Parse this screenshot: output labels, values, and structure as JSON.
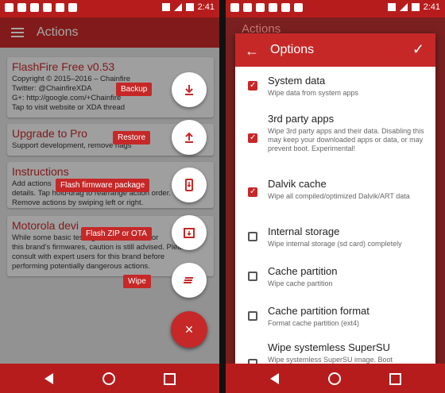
{
  "status": {
    "time": "2:41"
  },
  "left": {
    "appbar_title": "Actions",
    "cards": [
      {
        "title": "FlashFire Free v0.53",
        "lines": [
          "Copyright © 2015–2016 – Chainfire",
          "Twitter: @ChainfireXDA",
          "G+: http://google.com/+Chainfire",
          "Tap to visit website or XDA thread"
        ]
      },
      {
        "title": "Upgrade to Pro",
        "lines": [
          "Support development, remove nags"
        ]
      },
      {
        "title": "Instructions",
        "lines": [
          "Add actions",
          "details. Tap hold-drag to rearrange action order.",
          "Remove actions by swiping left or right."
        ]
      },
      {
        "title": "Motorola devi",
        "lines": [
          "While some basic testing has been done for",
          "this brand's firmwares, caution is still advised. Please",
          "consult with expert users for this brand before",
          "performing potentially dangerous actions."
        ]
      }
    ],
    "fab_labels": {
      "backup": "Backup",
      "restore": "Restore",
      "flash_firmware": "Flash firmware package",
      "flash_zip": "Flash ZIP or OTA",
      "wipe": "Wipe"
    },
    "fab_main": "×"
  },
  "right": {
    "bg_title": "Actions",
    "dialog_title": "Options",
    "back_glyph": "←",
    "confirm_glyph": "✓",
    "options": [
      {
        "title": "System data",
        "desc": "Wipe data from system apps",
        "checked": true
      },
      {
        "title": "3rd party apps",
        "desc": "Wipe 3rd party apps and their data. Disabling this may keep your downloaded apps or data, or may prevent boot. Experimental!",
        "checked": true
      },
      {
        "title": "Dalvik cache",
        "desc": "Wipe all compiled/optimized Dalvik/ART data",
        "checked": true
      },
      {
        "title": "Internal storage",
        "desc": "Wipe internal storage (sd card) completely",
        "checked": false
      },
      {
        "title": "Cache partition",
        "desc": "Wipe cache partition",
        "checked": false
      },
      {
        "title": "Cache partition format",
        "desc": "Format cache partition (ext4)",
        "checked": false
      },
      {
        "title": "Wipe systemless SuperSU",
        "desc": "Wipe systemless SuperSU image. Boot",
        "checked": false
      }
    ]
  },
  "colors": {
    "accent": "#c62828",
    "status": "#b71c1c"
  }
}
